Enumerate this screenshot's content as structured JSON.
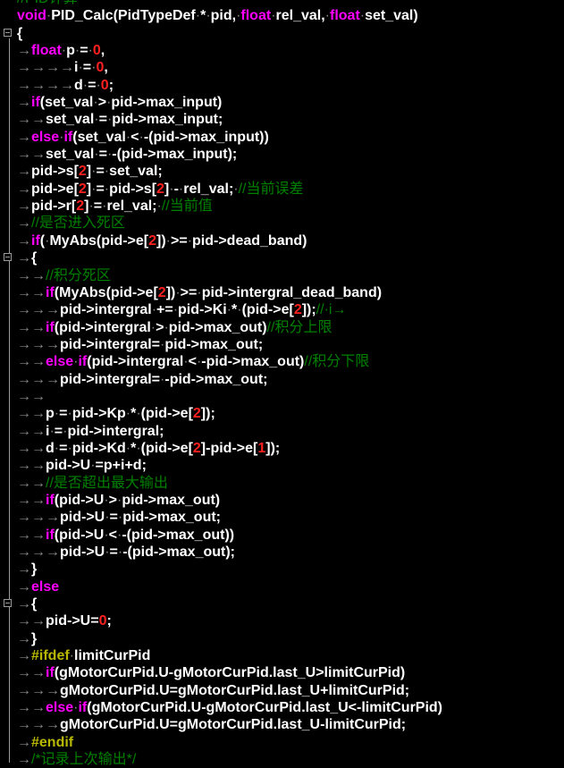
{
  "editor": {
    "language": "C",
    "colors": {
      "background": "#000000",
      "text": "#ffffff",
      "keyword": "#ff00ff",
      "number": "#ff2020",
      "comment": "#008000",
      "preprocessor": "#b8b800",
      "whitespace_marker": "#888888",
      "bracket_highlight": "#8b0000"
    },
    "whitespace_markers": {
      "tab": "→",
      "space": "·"
    },
    "fold_markers": [
      "{",
      "{",
      "{"
    ],
    "lines": [
      [
        [
          "cm",
          "//PID计算"
        ]
      ],
      [
        [
          "kw",
          "void"
        ],
        [
          "sp",
          ""
        ],
        [
          "t",
          "PID_Calc(PidTypeDef"
        ],
        [
          "sp",
          ""
        ],
        [
          "t",
          "*"
        ],
        [
          "sp",
          ""
        ],
        [
          "t",
          "pid,"
        ],
        [
          "sp",
          ""
        ],
        [
          "kw",
          "float"
        ],
        [
          "sp",
          ""
        ],
        [
          "t",
          "rel_val,"
        ],
        [
          "sp",
          ""
        ],
        [
          "kw",
          "float"
        ],
        [
          "sp",
          ""
        ],
        [
          "t",
          "set_val)"
        ]
      ],
      [
        [
          "t",
          "{"
        ]
      ],
      [
        [
          "tab",
          1
        ],
        [
          "kw",
          "float"
        ],
        [
          "sp",
          ""
        ],
        [
          "t",
          "p"
        ],
        [
          "sp",
          ""
        ],
        [
          "t",
          "="
        ],
        [
          "sp",
          ""
        ],
        [
          "num",
          "0"
        ],
        [
          "t",
          ","
        ]
      ],
      [
        [
          "tab",
          4
        ],
        [
          "t",
          "i"
        ],
        [
          "sp",
          ""
        ],
        [
          "t",
          "="
        ],
        [
          "sp",
          ""
        ],
        [
          "num",
          "0"
        ],
        [
          "t",
          ","
        ]
      ],
      [
        [
          "tab",
          4
        ],
        [
          "t",
          "d"
        ],
        [
          "sp",
          ""
        ],
        [
          "t",
          "="
        ],
        [
          "sp",
          ""
        ],
        [
          "num",
          "0"
        ],
        [
          "t",
          ";"
        ]
      ],
      [
        [
          "tab",
          1
        ],
        [
          "kw",
          "if"
        ],
        [
          "t",
          "(set_val"
        ],
        [
          "sp",
          ""
        ],
        [
          "t",
          ">"
        ],
        [
          "sp",
          ""
        ],
        [
          "t",
          "pid->max_input)"
        ]
      ],
      [
        [
          "tab",
          2
        ],
        [
          "t",
          "set_val"
        ],
        [
          "sp",
          ""
        ],
        [
          "t",
          "="
        ],
        [
          "sp",
          ""
        ],
        [
          "t",
          "pid->max_input;"
        ]
      ],
      [
        [
          "tab",
          1
        ],
        [
          "kw",
          "else"
        ],
        [
          "sp",
          ""
        ],
        [
          "kw",
          "if"
        ],
        [
          "t",
          "(set_val"
        ],
        [
          "sp",
          ""
        ],
        [
          "t",
          "<"
        ],
        [
          "sp",
          ""
        ],
        [
          "t",
          "-(pid->max_input))"
        ]
      ],
      [
        [
          "tab",
          2
        ],
        [
          "t",
          "set_val"
        ],
        [
          "sp",
          ""
        ],
        [
          "t",
          "="
        ],
        [
          "sp",
          ""
        ],
        [
          "t",
          "-(pid->max_input);"
        ]
      ],
      [
        [
          "tab",
          1
        ],
        [
          "t",
          "pid->s["
        ],
        [
          "num",
          "2"
        ],
        [
          "t",
          "]"
        ],
        [
          "sp",
          ""
        ],
        [
          "t",
          "="
        ],
        [
          "sp",
          ""
        ],
        [
          "t",
          "set_val;"
        ]
      ],
      [
        [
          "tab",
          1
        ],
        [
          "t",
          "pid->e["
        ],
        [
          "num",
          "2"
        ],
        [
          "t",
          "]"
        ],
        [
          "sp",
          ""
        ],
        [
          "t",
          "="
        ],
        [
          "sp",
          ""
        ],
        [
          "t",
          "pid->s["
        ],
        [
          "num",
          "2"
        ],
        [
          "t",
          "]"
        ],
        [
          "sp",
          ""
        ],
        [
          "t",
          "-"
        ],
        [
          "sp",
          ""
        ],
        [
          "t",
          "rel_val;"
        ],
        [
          "sp",
          ""
        ],
        [
          "cm",
          "//当前误差"
        ]
      ],
      [
        [
          "tab",
          1
        ],
        [
          "t",
          "pid->r["
        ],
        [
          "num",
          "2"
        ],
        [
          "t",
          "]"
        ],
        [
          "sp",
          ""
        ],
        [
          "t",
          "="
        ],
        [
          "sp",
          ""
        ],
        [
          "t",
          "rel_val;"
        ],
        [
          "sp",
          ""
        ],
        [
          "cm",
          "//当前值"
        ]
      ],
      [
        [
          "tab",
          1
        ],
        [
          "cm",
          "//是否进入死区"
        ]
      ],
      [
        [
          "tab",
          1
        ],
        [
          "kw",
          "if"
        ],
        [
          "t",
          "("
        ],
        [
          "sp",
          ""
        ],
        [
          "t",
          "MyAbs(pid->e["
        ],
        [
          "num",
          "2"
        ],
        [
          "t",
          "])"
        ],
        [
          "sp",
          ""
        ],
        [
          "t",
          ">="
        ],
        [
          "sp",
          ""
        ],
        [
          "t",
          "pid->dead_band)"
        ]
      ],
      [
        [
          "tab",
          1
        ],
        [
          "t",
          "{"
        ]
      ],
      [
        [
          "tab",
          2
        ],
        [
          "cm",
          "//积分死区"
        ]
      ],
      [
        [
          "tab",
          2
        ],
        [
          "kw",
          "if"
        ],
        [
          "t",
          "(MyAbs(pid->e["
        ],
        [
          "num",
          "2"
        ],
        [
          "t",
          "])"
        ],
        [
          "sp",
          ""
        ],
        [
          "t",
          ">="
        ],
        [
          "sp",
          ""
        ],
        [
          "t",
          "pid->intergral_dead_band)"
        ]
      ],
      [
        [
          "tab",
          3
        ],
        [
          "t",
          "pid->intergral"
        ],
        [
          "sp",
          ""
        ],
        [
          "t",
          "+="
        ],
        [
          "sp",
          ""
        ],
        [
          "t",
          "pid->Ki"
        ],
        [
          "sp",
          ""
        ],
        [
          "t",
          "*"
        ],
        [
          "sp",
          ""
        ],
        [
          "t",
          "(pid->e["
        ],
        [
          "num",
          "2"
        ],
        [
          "t",
          "]);"
        ],
        [
          "cm",
          "//·i→"
        ]
      ],
      [
        [
          "tab",
          2
        ],
        [
          "kw",
          "if"
        ],
        [
          "t",
          "(pid->intergral"
        ],
        [
          "sp",
          ""
        ],
        [
          "t",
          ">"
        ],
        [
          "sp",
          ""
        ],
        [
          "t",
          "pid->max_out)"
        ],
        [
          "cm",
          "//积分上限"
        ]
      ],
      [
        [
          "tab",
          3
        ],
        [
          "t",
          "pid->intergral="
        ],
        [
          "sp",
          ""
        ],
        [
          "t",
          "pid->max_out;"
        ]
      ],
      [
        [
          "tab",
          2
        ],
        [
          "kw",
          "else"
        ],
        [
          "sp",
          ""
        ],
        [
          "kw",
          "if"
        ],
        [
          "t",
          "(pid->intergral"
        ],
        [
          "sp",
          ""
        ],
        [
          "t",
          "<"
        ],
        [
          "sp",
          ""
        ],
        [
          "t",
          "-pid->max_out)"
        ],
        [
          "cm",
          "//积分下限"
        ]
      ],
      [
        [
          "tab",
          3
        ],
        [
          "t",
          "pid->intergral="
        ],
        [
          "sp",
          ""
        ],
        [
          "t",
          "-pid->max_out;"
        ]
      ],
      [
        [
          "tab",
          2
        ]
      ],
      [
        [
          "tab",
          2
        ],
        [
          "t",
          "p"
        ],
        [
          "sp",
          ""
        ],
        [
          "t",
          "="
        ],
        [
          "sp",
          ""
        ],
        [
          "t",
          "pid->Kp"
        ],
        [
          "sp",
          ""
        ],
        [
          "t",
          "*"
        ],
        [
          "sp",
          ""
        ],
        [
          "t",
          "(pid->e["
        ],
        [
          "num",
          "2"
        ],
        [
          "t",
          "]);"
        ]
      ],
      [
        [
          "tab",
          2
        ],
        [
          "t",
          "i"
        ],
        [
          "sp",
          ""
        ],
        [
          "t",
          "="
        ],
        [
          "sp",
          ""
        ],
        [
          "t",
          "pid->intergral;"
        ]
      ],
      [
        [
          "tab",
          2
        ],
        [
          "t",
          "d"
        ],
        [
          "sp",
          ""
        ],
        [
          "t",
          "="
        ],
        [
          "sp",
          ""
        ],
        [
          "t",
          "pid->Kd"
        ],
        [
          "sp",
          ""
        ],
        [
          "t",
          "*"
        ],
        [
          "sp",
          ""
        ],
        [
          "t",
          "(pid->e["
        ],
        [
          "num",
          "2"
        ],
        [
          "t",
          "]-pid->e["
        ],
        [
          "num",
          "1"
        ],
        [
          "t",
          "]);"
        ]
      ],
      [
        [
          "tab",
          2
        ],
        [
          "t",
          "pid->U"
        ],
        [
          "sp",
          ""
        ],
        [
          "t",
          "=p+i+d;"
        ]
      ],
      [
        [
          "tab",
          2
        ],
        [
          "cm",
          "//是否超出最大输出"
        ]
      ],
      [
        [
          "tab",
          2
        ],
        [
          "kw",
          "if"
        ],
        [
          "t",
          "(pid->U"
        ],
        [
          "sp",
          ""
        ],
        [
          "t",
          ">"
        ],
        [
          "sp",
          ""
        ],
        [
          "t",
          "pid->max_out)"
        ]
      ],
      [
        [
          "tab",
          3
        ],
        [
          "t",
          "pid->U"
        ],
        [
          "sp",
          ""
        ],
        [
          "t",
          "="
        ],
        [
          "sp",
          ""
        ],
        [
          "t",
          "pid->max_out;"
        ]
      ],
      [
        [
          "tab",
          2
        ],
        [
          "kw",
          "if"
        ],
        [
          "t",
          "(pid->U"
        ],
        [
          "sp",
          ""
        ],
        [
          "t",
          "<"
        ],
        [
          "sp",
          ""
        ],
        [
          "t",
          "-(pid->max_out))"
        ]
      ],
      [
        [
          "tab",
          3
        ],
        [
          "t",
          "pid->U"
        ],
        [
          "sp",
          ""
        ],
        [
          "t",
          "="
        ],
        [
          "sp",
          ""
        ],
        [
          "t",
          "-(pid->max_out);"
        ]
      ],
      [
        [
          "tab",
          1
        ],
        [
          "t",
          "}"
        ]
      ],
      [
        [
          "tab",
          1
        ],
        [
          "kw",
          "else"
        ]
      ],
      [
        [
          "tab",
          1
        ],
        [
          "t",
          "{"
        ]
      ],
      [
        [
          "tab",
          2
        ],
        [
          "t",
          "pid->U="
        ],
        [
          "num",
          "0"
        ],
        [
          "t",
          ";"
        ]
      ],
      [
        [
          "tab",
          1
        ],
        [
          "t",
          "}"
        ]
      ],
      [
        [
          "tab",
          1
        ],
        [
          "pp",
          "#ifdef"
        ],
        [
          "sp",
          ""
        ],
        [
          "t",
          "limitCurPid"
        ]
      ],
      [
        [
          "tab",
          2
        ],
        [
          "kw",
          "if"
        ],
        [
          "t",
          "(gMotorCurPid.U-gMotorCurPid.last_U>limitCurPid)"
        ]
      ],
      [
        [
          "tab",
          3
        ],
        [
          "t",
          "gMotorCurPid.U=gMotorCurPid.last_U+limitCurPid;"
        ]
      ],
      [
        [
          "tab",
          2
        ],
        [
          "kw",
          "else"
        ],
        [
          "sp",
          ""
        ],
        [
          "kw",
          "if"
        ],
        [
          "t",
          "(gMotorCurPid.U-gMotorCurPid.last_U<-limitCurPid)"
        ]
      ],
      [
        [
          "tab",
          3
        ],
        [
          "t",
          "gMotorCurPid.U=gMotorCurPid.last_U-limitCurPid;"
        ]
      ],
      [
        [
          "tab",
          1
        ],
        [
          "pp",
          "#endif"
        ]
      ],
      [
        [
          "tab",
          1
        ],
        [
          "cm",
          "/*记录上次输出*/"
        ]
      ]
    ]
  }
}
